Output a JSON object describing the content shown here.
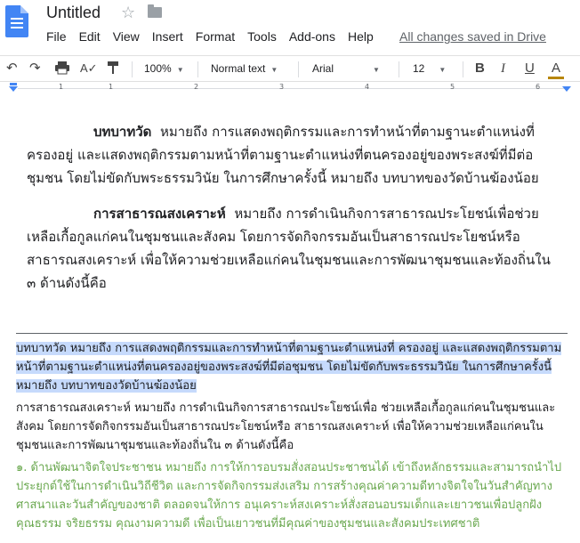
{
  "app": {
    "doc_title": "Untitled",
    "saved_status": "All changes saved in Drive"
  },
  "menu": [
    "File",
    "Edit",
    "View",
    "Insert",
    "Format",
    "Tools",
    "Add-ons",
    "Help"
  ],
  "toolbar": {
    "zoom": "100%",
    "style": "Normal text",
    "font": "Arial",
    "font_size": "12",
    "bold_label": "B",
    "italic_label": "I",
    "underline_label": "U",
    "text_color_label": "A",
    "icons": [
      "undo-icon",
      "redo-icon",
      "print-icon",
      "spellcheck-icon",
      "paint-format-icon"
    ]
  },
  "ruler": {
    "numbers": [
      "1",
      "1",
      "2",
      "3",
      "4",
      "5",
      "6"
    ]
  },
  "document": {
    "scan": {
      "p1_term": "บทบาทวัด",
      "p1_text": "หมายถึง  การแสดงพฤติกรรมและการทำหน้าที่ตามฐานะตำแหน่งที่ครองอยู่ และแสดงพฤติกรรมตามหน้าที่ตามฐานะตำแหน่งที่ตนครองอยู่ของพระสงฆ์ที่มีต่อชุมชน โดยไม่ขัดกับพระธรรมวินัย ในการศึกษาครั้งนี้ หมายถึง บทบาทของวัดบ้านฆ้องน้อย",
      "p2_term": "การสาธารณสงเคราะห์",
      "p2_text": "หมายถึง การดำเนินกิจการสาธารณประโยชน์เพื่อช่วยเหลือเกื้อกูลแก่คนในชุมชนและสังคม โดยการจัดกิจกรรมอันเป็นสาธารณประโยชน์หรือสาธารณสงเคราะห์ เพื่อให้ความช่วยเหลือแก่คนในชุมชนและการพัฒนาชุมชนและท้องถิ่นใน ๓ ด้านดังนี้คือ"
    },
    "ocr": {
      "p1": "บทบาทวัด หมายถึง การแสดงพฤติกรรมและการทำหน้าที่ตามฐานะตำแหน่งที่ ครองอยู่ และแสดงพฤติกรรมตามหน้าที่ตามฐานะตำแหน่งที่ตนครองอยู่ของพระสงฆ์ที่มีต่อชุมชน โดยไม่ขัดกับพระธรรมวินัย ในการศึกษาครั้งนี้ หมายถึง บทบาทของวัดบ้านฆ้องน้อย",
      "p2": "การสาธารณสงเคราะห์ หมายถึง การดำเนินกิจการสาธารณประโยชน์เพื่อ ช่วยเหลือเกื้อกูลแก่คนในชุมชนและสังคม โดยการจัดกิจกรรมอันเป็นสาธารณประโยชน์หรือ สาธารณสงเคราะห์ เพื่อให้ความช่วยเหลือแก่คนในชุมชนและการพัฒนาชุมชนและท้องถิ่นใน ๓ ด้านดังนี้คือ",
      "p3": "๑. ด้านพัฒนาจิตใจประชาชน หมายถึง การให้การอบรมสั่งสอนประชาชนได้ เข้าถึงหลักธรรมและสามารถนำไปประยุกต์ใช้ในการดำเนินวิถีชีวิต และการจัดกิจกรรมส่งเสริม การสร้างคุณค่าความดีทางจิตใจในวันสำคัญทางศาสนาและวันสำคัญของชาติ ตลอดจนให้การ อนุเคราะห์สงเคราะห์สั่งสอนอบรมเด็กและเยาวชนเพื่อปลูกฝังคุณธรรม จริยธรรม คุณงามความดี เพื่อเป็นเยาวชนที่มีคุณค่าของชุมชนและสังคมประเทศชาติ"
    },
    "colors": {
      "highlight": "#c6dafc",
      "green_text": "#6aa84f"
    }
  }
}
